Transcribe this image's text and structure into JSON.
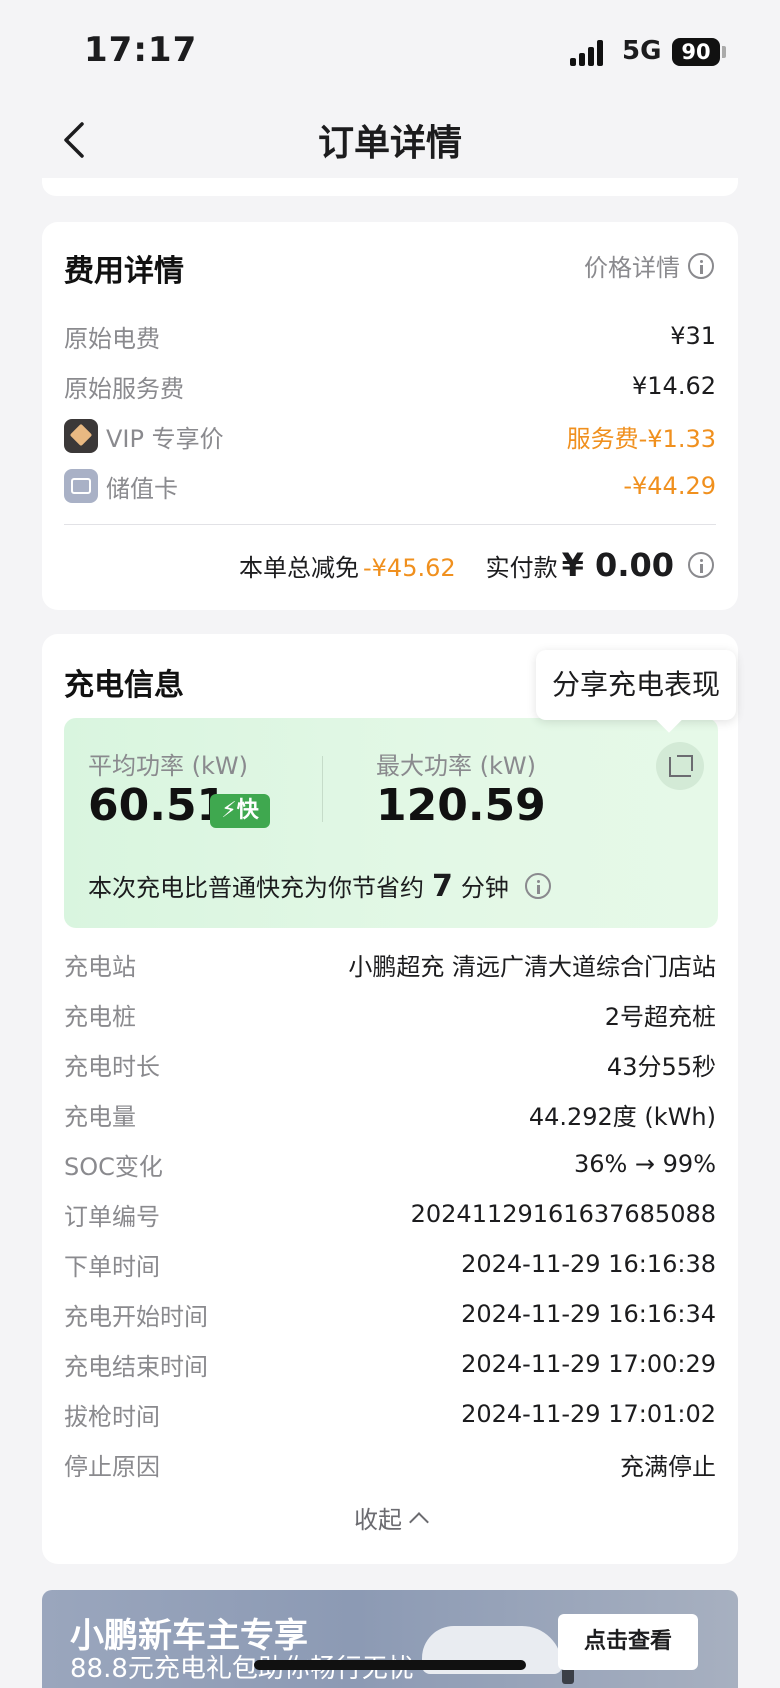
{
  "status_bar": {
    "time": "17:17",
    "network": "5G",
    "battery": "90"
  },
  "nav": {
    "title": "订单详情"
  },
  "fee_card": {
    "title": "费用详情",
    "price_link": "价格详情",
    "rows": [
      {
        "label": "原始电费",
        "value": "¥31",
        "icon": "",
        "highlight": false
      },
      {
        "label": "原始服务费",
        "value": "¥14.62",
        "icon": "",
        "highlight": false
      },
      {
        "label": "VIP 专享价",
        "value": "服务费-¥1.33",
        "icon": "vip-icon",
        "highlight": true
      },
      {
        "label": "储值卡",
        "value": "-¥44.29",
        "icon": "card-icon",
        "highlight": true
      }
    ],
    "summary": {
      "discount_label": "本单总减免",
      "discount_value": "-¥45.62",
      "paid_label": "实付款",
      "paid_value": "¥ 0.00"
    }
  },
  "charge_card": {
    "title": "充电信息",
    "tooltip": "分享充电表现",
    "avg_power_label": "平均功率 (kW)",
    "avg_power_value": "60.51",
    "fast_badge": "⚡快",
    "max_power_label": "最大功率 (kW)",
    "max_power_value": "120.59",
    "save_note_prefix": "本次充电比普通快充为你节省约",
    "save_note_minutes": "7",
    "save_note_suffix": "分钟",
    "rows": [
      {
        "label": "充电站",
        "value": "小鹏超充 清远广清大道综合门店站"
      },
      {
        "label": "充电桩",
        "value": "2号超充桩"
      },
      {
        "label": "充电时长",
        "value": "43分55秒"
      },
      {
        "label": "充电量",
        "value": "44.292度 (kWh)"
      },
      {
        "label": "SOC变化",
        "value": "36% → 99%"
      },
      {
        "label": "订单编号",
        "value": "20241129161637685088"
      },
      {
        "label": "下单时间",
        "value": "2024-11-29 16:16:38"
      },
      {
        "label": "充电开始时间",
        "value": "2024-11-29 16:16:34"
      },
      {
        "label": "充电结束时间",
        "value": "2024-11-29 17:00:29"
      },
      {
        "label": "拔枪时间",
        "value": "2024-11-29 17:01:02"
      },
      {
        "label": "停止原因",
        "value": "充满停止"
      }
    ],
    "collapse_label": "收起"
  },
  "banner": {
    "title": "小鹏新车主专享",
    "subtitle": "88.8元充电礼包助你畅行无忧",
    "button": "点击查看"
  },
  "colors": {
    "accent_orange": "#f0901e",
    "fast_green": "#3fa84f",
    "perf_bg": "#dff6e3"
  }
}
